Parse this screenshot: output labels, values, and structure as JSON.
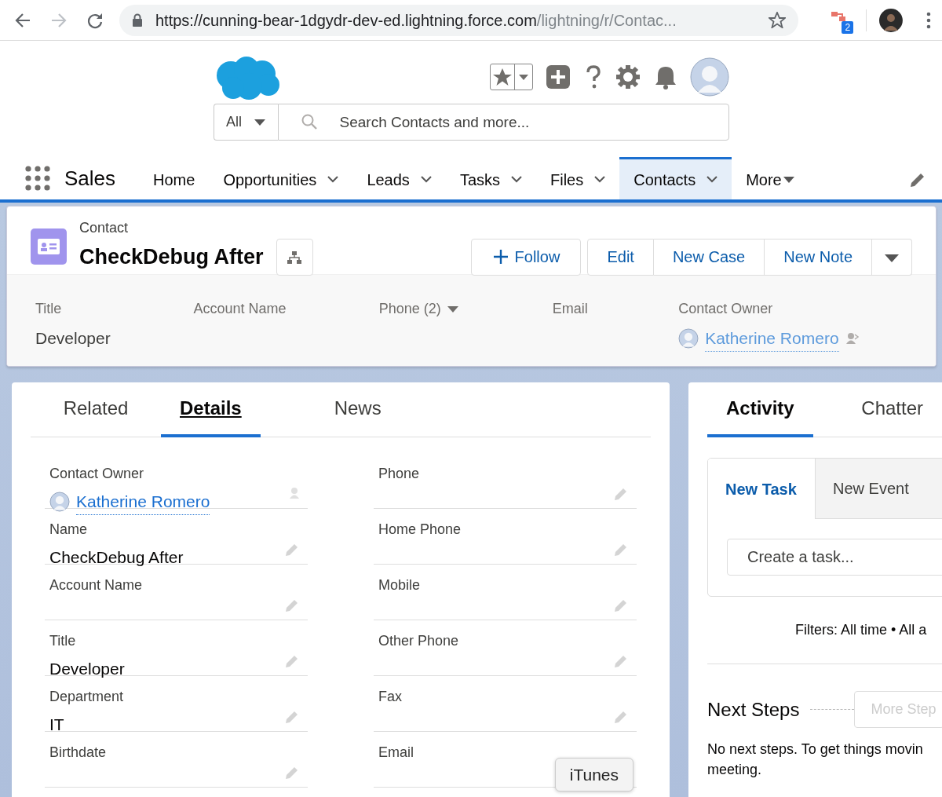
{
  "browser": {
    "url_host": "https://cunning-bear-1dgydr-dev-ed.lightning.force.com",
    "url_path": "/lightning/r/Contac...",
    "forward_disabled": true,
    "extension_badge": "2"
  },
  "header": {
    "search_scope": "All",
    "search_placeholder": "Search Contacts and more..."
  },
  "app": {
    "name": "Sales",
    "more": "More",
    "nav": [
      {
        "label": "Home",
        "dropdown": false,
        "selected": false
      },
      {
        "label": "Opportunities",
        "dropdown": true,
        "selected": false
      },
      {
        "label": "Leads",
        "dropdown": true,
        "selected": false
      },
      {
        "label": "Tasks",
        "dropdown": true,
        "selected": false
      },
      {
        "label": "Files",
        "dropdown": true,
        "selected": false
      },
      {
        "label": "Contacts",
        "dropdown": true,
        "selected": true
      }
    ]
  },
  "record": {
    "object": "Contact",
    "name": "CheckDebug After",
    "follow": "Follow",
    "actions": [
      "Edit",
      "New Case",
      "New Note"
    ],
    "highlights": [
      {
        "label": "Title",
        "value": "Developer",
        "kind": "text"
      },
      {
        "label": "Account Name",
        "kind": "text"
      },
      {
        "label": "Phone (2)",
        "kind": "dropdown"
      },
      {
        "label": "Email",
        "kind": "text"
      },
      {
        "label": "Contact Owner",
        "value": "Katherine Romero",
        "kind": "user"
      }
    ]
  },
  "details": {
    "tabs": [
      {
        "label": "Related",
        "selected": false
      },
      {
        "label": "Details",
        "selected": true
      },
      {
        "label": "News",
        "selected": false
      }
    ],
    "fields": [
      {
        "label": "Contact Owner",
        "value": "Katherine Romero",
        "kind": "user"
      },
      {
        "label": "Phone",
        "kind": "text"
      },
      {
        "label": "Name",
        "value": "CheckDebug After",
        "kind": "text"
      },
      {
        "label": "Home Phone",
        "kind": "text"
      },
      {
        "label": "Account Name",
        "kind": "text"
      },
      {
        "label": "Mobile",
        "kind": "text"
      },
      {
        "label": "Title",
        "value": "Developer",
        "kind": "text"
      },
      {
        "label": "Other Phone",
        "kind": "text"
      },
      {
        "label": "Department",
        "value": "IT",
        "kind": "text"
      },
      {
        "label": "Fax",
        "kind": "text"
      },
      {
        "label": "Birthdate",
        "kind": "text"
      },
      {
        "label": "Email",
        "kind": "text"
      }
    ],
    "tooltip": "iTunes"
  },
  "activity": {
    "tabs": [
      {
        "label": "Activity",
        "selected": true
      },
      {
        "label": "Chatter",
        "selected": false
      }
    ],
    "composer_tabs": [
      {
        "label": "New Task",
        "selected": true
      },
      {
        "label": "New Event",
        "selected": false
      }
    ],
    "task_placeholder": "Create a task...",
    "filters": "Filters: All time • All a",
    "next_steps": "Next Steps",
    "more_steps": "More Step",
    "message_lines": [
      "No next steps. To get things movin",
      "meeting."
    ]
  }
}
